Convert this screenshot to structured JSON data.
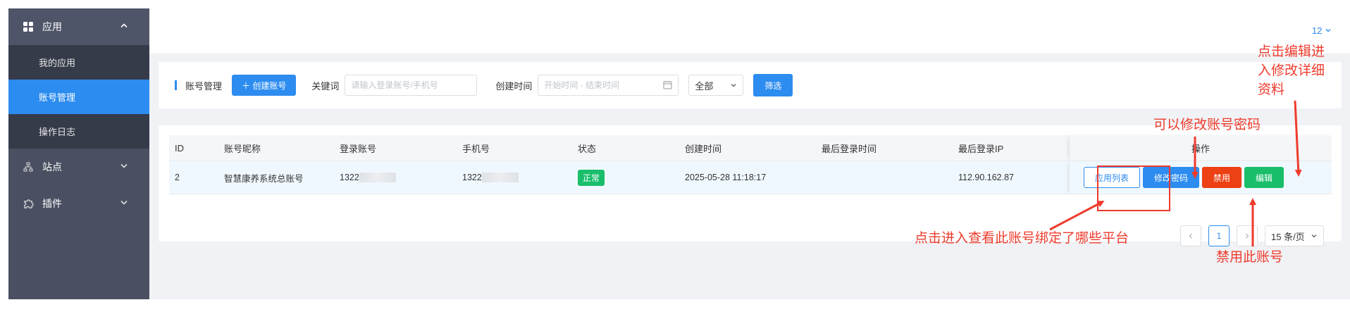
{
  "sidebar": {
    "apps_group": "应用",
    "my_apps": "我的应用",
    "account_mgmt": "账号管理",
    "op_log": "操作日志",
    "sites_group": "站点",
    "plugins_group": "插件"
  },
  "header": {
    "version": "12"
  },
  "filter": {
    "section_title": "账号管理",
    "create_btn": "＋ 创建账号",
    "keyword_label": "关键词",
    "keyword_placeholder": "请输入登录账号/手机号",
    "created_label": "创建时间",
    "date_placeholder": "开始时间 - 结束时间",
    "status_value": "全部",
    "filter_btn": "筛选"
  },
  "table": {
    "headers": [
      "ID",
      "账号昵称",
      "登录账号",
      "手机号",
      "状态",
      "创建时间",
      "最后登录时间",
      "最后登录IP",
      "操作"
    ],
    "row": {
      "id": "2",
      "nickname": "智慧康养系统总账号",
      "login_prefix": "1322",
      "phone_prefix": "1322",
      "status": "正常",
      "created": "2025-05-28 11:18:17",
      "last_login": "",
      "last_ip": "112.90.162.87"
    },
    "actions": {
      "app_list": "应用列表",
      "change_pwd": "修改密码",
      "disable": "禁用",
      "edit": "编辑"
    }
  },
  "pagination": {
    "current": "1",
    "page_size": "15 条/页"
  },
  "annotations": {
    "edit": [
      "点击编辑进",
      "入修改详细",
      "资料"
    ],
    "password": "可以修改账号密码",
    "app_list": "点击进入查看此账号绑定了哪些平台",
    "disable": "禁用此账号"
  },
  "colors": {
    "primary": "#2d8cf0",
    "danger": "#ed4014",
    "success": "#19be6b",
    "sidebar": "#4a5061",
    "annotation": "#ef3b2c"
  }
}
